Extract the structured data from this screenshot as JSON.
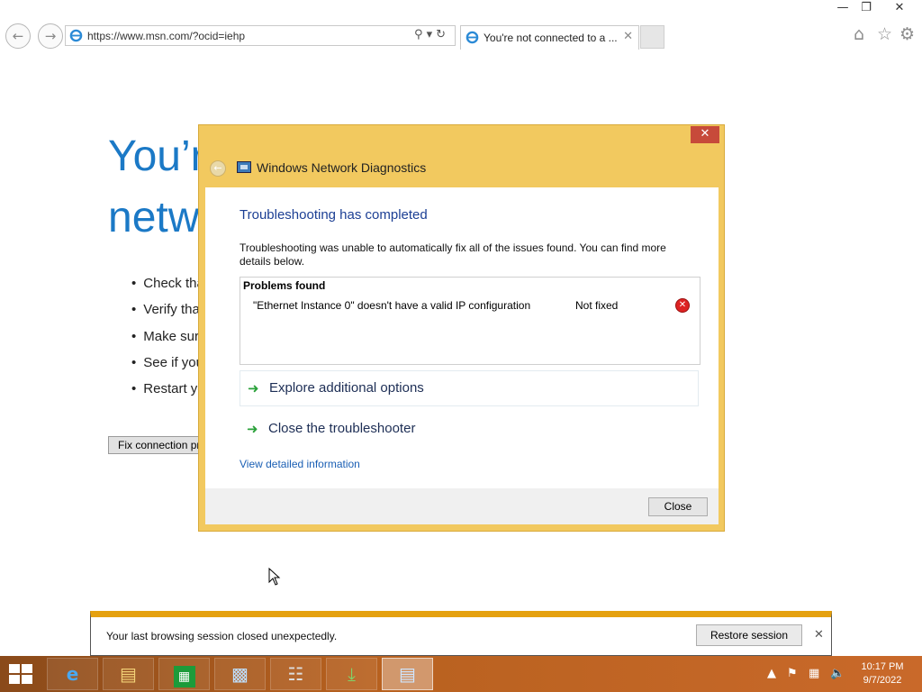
{
  "browser": {
    "address": {
      "url": "https://www.msn.com/?ocid=iehp"
    },
    "tab": {
      "title": "You're not connected to a ..."
    }
  },
  "page": {
    "heading_line1": "You’r",
    "heading_line2": "netw",
    "bullets": [
      "Check tha",
      "Verify tha",
      "Make sur",
      "See if you",
      "Restart yo"
    ],
    "fix_button": "Fix connection pr"
  },
  "dialog": {
    "title": "Windows Network Diagnostics",
    "heading": "Troubleshooting has completed",
    "description": "Troubleshooting was unable to automatically fix all of the issues found. You can find more details below.",
    "problems_header": "Problems found",
    "problem": {
      "text": "\"Ethernet Instance 0\" doesn't have a valid IP configuration",
      "status": "Not fixed"
    },
    "options": [
      "Explore additional options",
      "Close the troubleshooter"
    ],
    "detail_link": "View detailed information",
    "close_button": "Close"
  },
  "notification": {
    "text": "Your last browsing session closed unexpectedly.",
    "restore_button": "Restore session"
  },
  "taskbar": {
    "clock_time": "10:17 PM",
    "clock_date": "9/7/2022"
  },
  "colors": {
    "dialog_frame": "#f2c95f",
    "heading_blue": "#1b79c6",
    "notification_accent": "#e5a10f",
    "taskbar": "#b8611f"
  }
}
